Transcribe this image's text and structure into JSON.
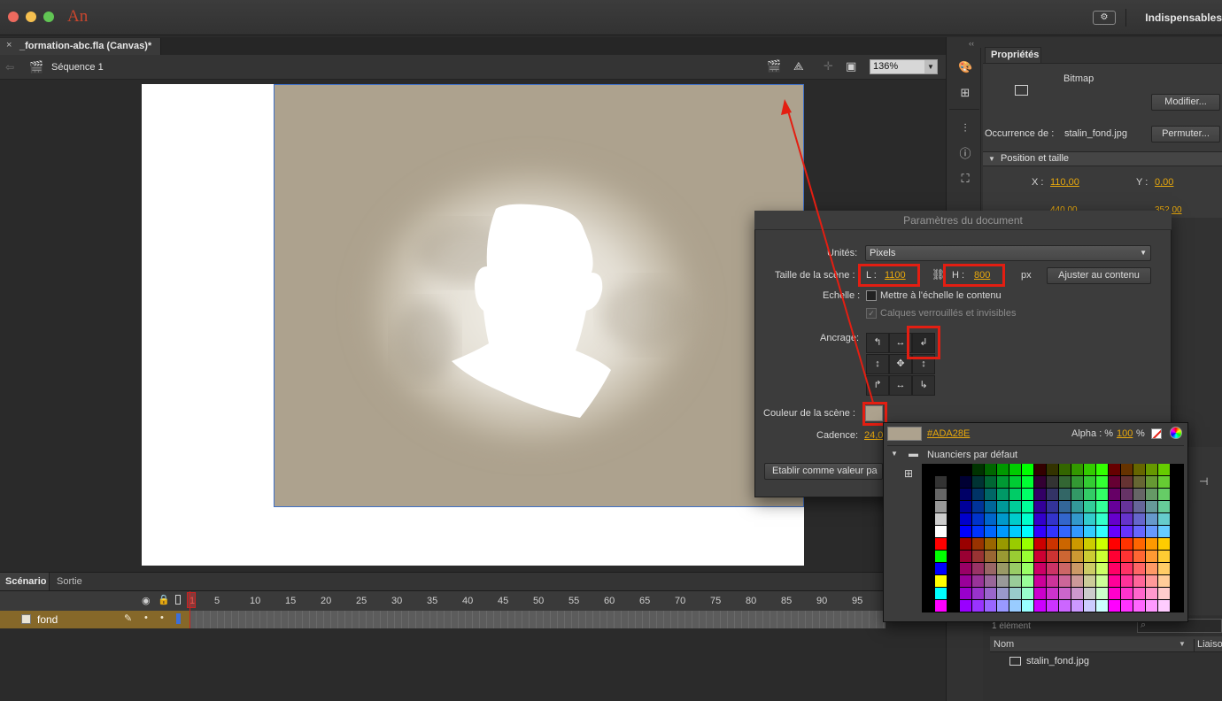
{
  "app": {
    "logo": "An",
    "workspace": "Indispensables",
    "workspace_icon": "workspace-switcher-icon"
  },
  "document": {
    "tab_title": "_formation-abc.fla (Canvas)*",
    "breadcrumb": "Séquence 1",
    "zoom": "136%"
  },
  "timeline": {
    "tabs": [
      "Scénario",
      "Sortie"
    ],
    "frame_numbers": [
      "1",
      "5",
      "10",
      "15",
      "20",
      "25",
      "30",
      "35",
      "40",
      "45",
      "50",
      "55",
      "60",
      "65",
      "70",
      "75",
      "80",
      "85",
      "90",
      "95"
    ],
    "layer_name": "fond"
  },
  "properties": {
    "tab": "Propriétés",
    "type": "Bitmap",
    "modify_button": "Modifier...",
    "instance_label": "Occurrence de :",
    "instance_value": "stalin_fond.jpg",
    "swap_button": "Permuter...",
    "section_position": "Position et taille",
    "x_label": "X :",
    "x_value": "110,00",
    "y_label": "Y :",
    "y_value": "0,00",
    "w_partial": "440,00",
    "h_partial": "352,00"
  },
  "dialog": {
    "title": "Paramètres du document",
    "units_label": "Unités:",
    "units_value": "Pixels",
    "stage_size_label": "Taille de la scène :",
    "width_label": "L :",
    "width_value": "1100",
    "height_label": "H :",
    "height_value": "800",
    "px": "px",
    "fit_button": "Ajuster au contenu",
    "scale_label": "Echelle :",
    "scale_checkbox": "Mettre à l'échelle le contenu",
    "locked_checkbox": "Calques verrouillés et invisibles",
    "anchor_label": "Ancrage:",
    "stage_color_label": "Couleur de la scène :",
    "stage_color": "#ada28e",
    "framerate_label": "Cadence:",
    "framerate_value": "24,0",
    "default_button": "Etablir comme valeur pa"
  },
  "color_picker": {
    "hex": "#ADA28E",
    "alpha_label": "Alpha : %",
    "alpha_value": "100",
    "alpha_suffix": "%",
    "swatches_folder": "Nuanciers par défaut"
  },
  "library": {
    "count": "1 élément",
    "col_name": "Nom",
    "col_link": "Liaiso",
    "item": "stalin_fond.jpg"
  },
  "colors": {
    "highlight": "#e31e12",
    "accent_value": "#e8a80c",
    "layer": "#866829"
  }
}
